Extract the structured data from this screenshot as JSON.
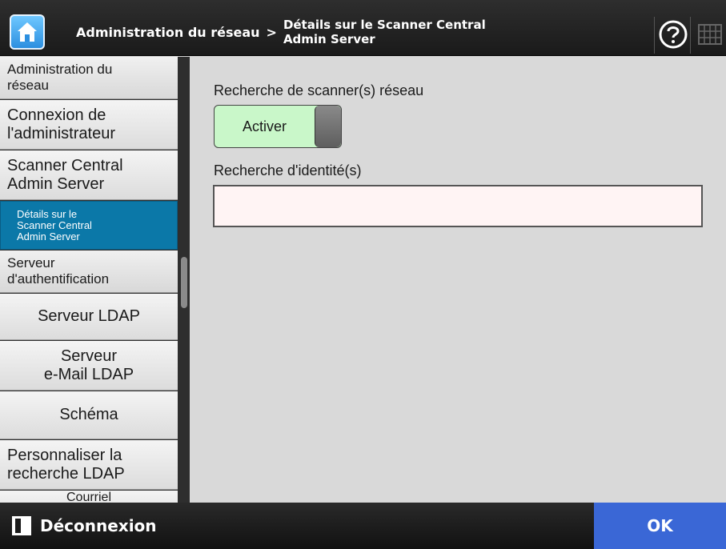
{
  "header": {
    "breadcrumb_parent": "Administration du réseau",
    "breadcrumb_separator": ">",
    "breadcrumb_current": "Détails sur le Scanner Central\nAdmin Server"
  },
  "sidebar": {
    "items": [
      {
        "label": "Administration du\nréseau",
        "kind": "group"
      },
      {
        "label": "Connexion de\nl'administrateur",
        "kind": "item"
      },
      {
        "label": "Scanner Central\nAdmin Server",
        "kind": "item"
      },
      {
        "label": "Détails sur le\nScanner Central\nAdmin Server",
        "kind": "subitem",
        "selected": true
      },
      {
        "label": "Serveur\nd'authentification",
        "kind": "group"
      },
      {
        "label": "Serveur LDAP",
        "kind": "item"
      },
      {
        "label": "Serveur\ne-Mail LDAP",
        "kind": "item"
      },
      {
        "label": "Schéma",
        "kind": "item"
      },
      {
        "label": "Personnaliser la\nrecherche LDAP",
        "kind": "item"
      },
      {
        "label": "Courriel",
        "kind": "item"
      }
    ]
  },
  "main": {
    "scanner_search_label": "Recherche de scanner(s) réseau",
    "toggle_value": "Activer",
    "identity_search_label": "Recherche d'identité(s)",
    "identity_search_value": ""
  },
  "footer": {
    "logout_label": "Déconnexion",
    "ok_label": "OK"
  },
  "colors": {
    "selected_subitem": "#0b78a8",
    "toggle_on": "#c9f7c9",
    "ok_button": "#3a67d6",
    "input_bg": "#fff4f4"
  },
  "icons": [
    "home-icon",
    "help-icon",
    "keyboard-icon",
    "logout-icon"
  ]
}
